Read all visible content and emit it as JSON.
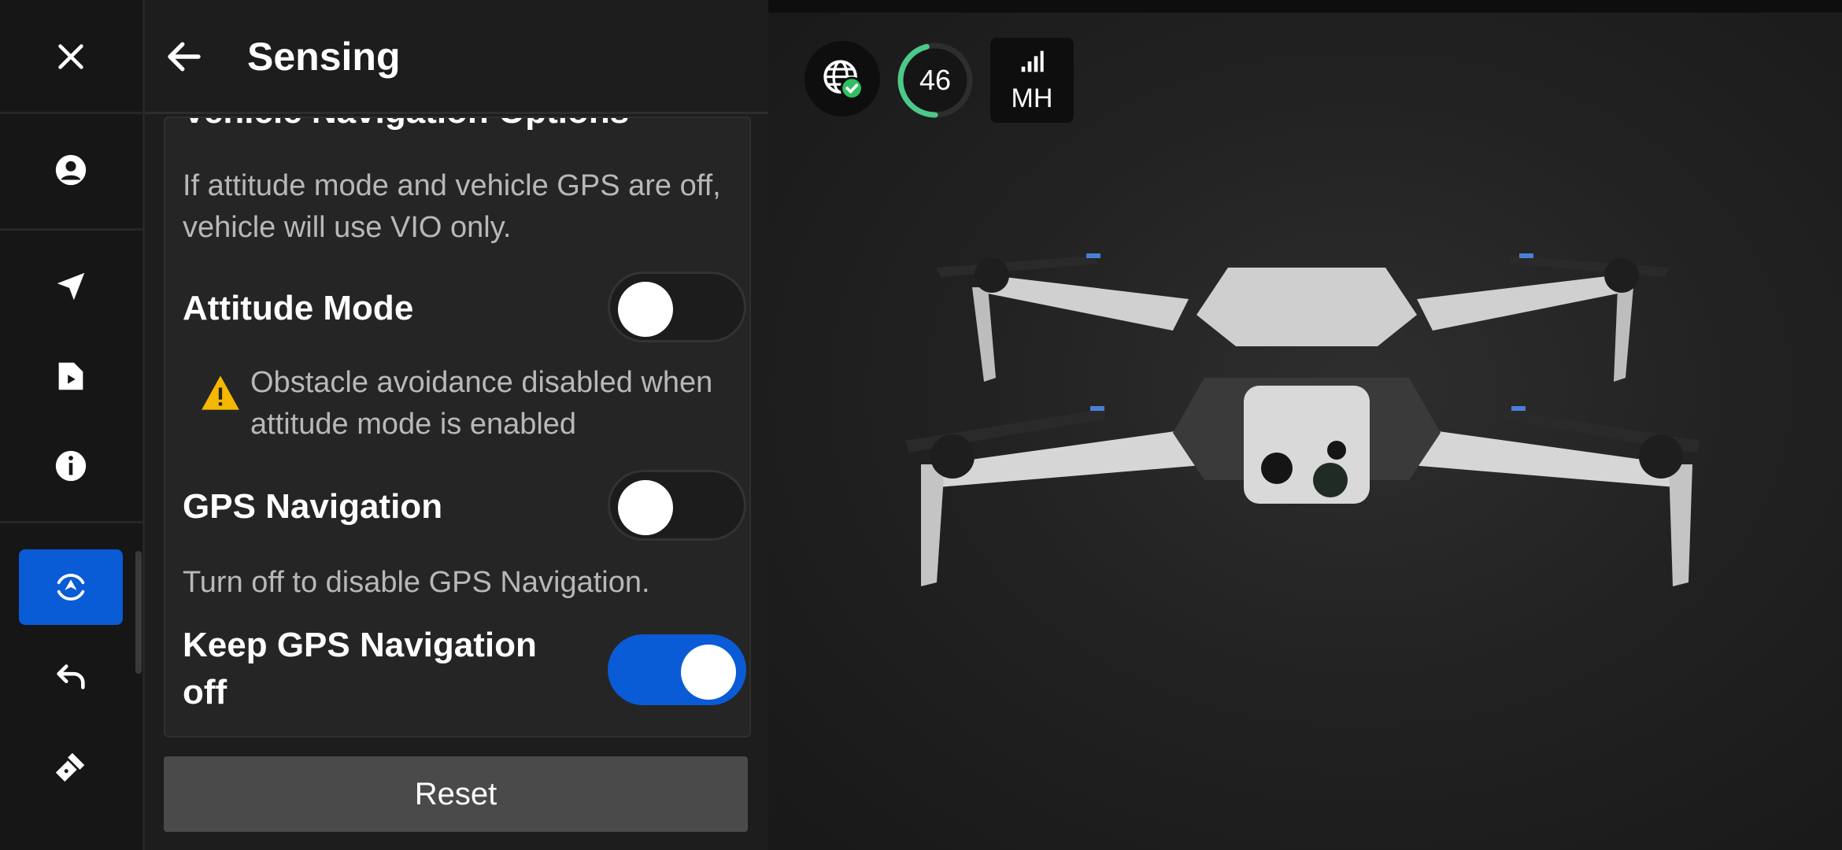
{
  "header": {
    "title": "Sensing"
  },
  "section": {
    "heading": "Vehicle Navigation Options",
    "description": "If attitude mode and vehicle GPS are off, vehicle will use VIO only."
  },
  "settings": [
    {
      "label": "Attitude Mode",
      "enabled": false
    },
    {
      "label": "GPS Navigation",
      "enabled": false
    },
    {
      "label": "Keep GPS Navigation off",
      "enabled": true
    }
  ],
  "warning": {
    "icon": "warning-icon",
    "text": "Obstacle avoidance disabled when attitude mode is enabled"
  },
  "gps_description": "Turn off to disable GPS Navigation.",
  "reset_label": "Reset",
  "status": {
    "battery_value": "46",
    "battery_level": 0.46,
    "signal_label": "MH",
    "globe_icon": "globe-check-icon",
    "signal_icon": "signal-bars-icon"
  },
  "rail": {
    "items": [
      {
        "icon": "close-icon"
      },
      {
        "icon": "account-icon"
      },
      {
        "icon": "navigation-arrow-icon"
      },
      {
        "icon": "media-file-icon"
      },
      {
        "icon": "info-icon"
      },
      {
        "icon": "sensing-icon",
        "active": true
      },
      {
        "icon": "return-icon"
      },
      {
        "icon": "flashlight-icon"
      }
    ]
  },
  "colors": {
    "accent": "#0a5bd6",
    "warning": "#f5b800",
    "battery_ring": "#4cc98a",
    "globe_check": "#2fbf5f"
  }
}
